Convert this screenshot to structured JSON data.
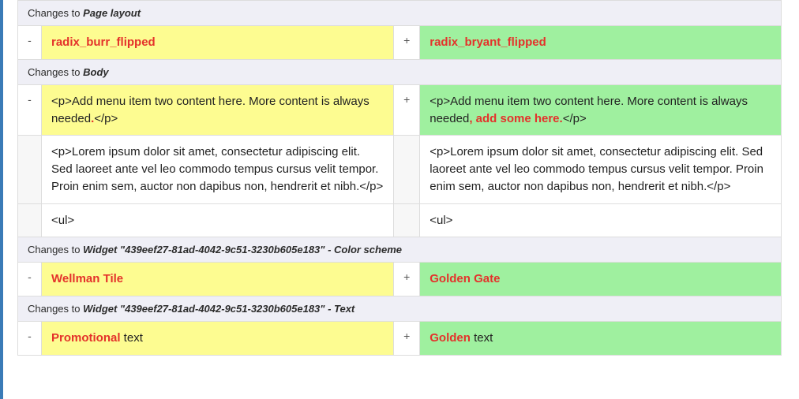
{
  "sections": [
    {
      "title_prefix": "Changes to ",
      "title_em": "Page layout",
      "title_suffix": "",
      "rows": [
        {
          "type": "change",
          "minus": "-",
          "plus": "+",
          "left_hl": "radix_burr_flipped",
          "left_plain": "",
          "right_hl": "radix_bryant_flipped",
          "right_plain": ""
        }
      ]
    },
    {
      "title_prefix": "Changes to ",
      "title_em": "Body",
      "title_suffix": "",
      "rows": [
        {
          "type": "change",
          "minus": "-",
          "plus": "+",
          "left_plain_pre": "<p>Add menu item two content here. More content is always needed",
          "left_hl": ".",
          "left_plain_post": "</p>",
          "right_plain_pre": "<p>Add menu item two content here. More content is always needed",
          "right_hl": ", add some here.",
          "right_plain_post": "</p>"
        },
        {
          "type": "context",
          "left": "<p>Lorem ipsum dolor sit amet, consectetur adipiscing elit. Sed laoreet ante vel leo commodo tempus cursus velit tempor. Proin enim sem, auctor non dapibus non, hendrerit et nibh.</p>",
          "right": "<p>Lorem ipsum dolor sit amet, consectetur adipiscing elit. Sed laoreet ante vel leo commodo tempus cursus velit tempor. Proin enim sem, auctor non dapibus non, hendrerit et nibh.</p>"
        },
        {
          "type": "context",
          "left": "<ul>",
          "right": "<ul>"
        }
      ]
    },
    {
      "title_prefix": "Changes to ",
      "title_em": "Widget \"439eef27-81ad-4042-9c51-3230b605e183\" - Color scheme",
      "title_suffix": "",
      "rows": [
        {
          "type": "change",
          "minus": "-",
          "plus": "+",
          "left_hl": "Wellman Tile",
          "left_plain": "",
          "right_hl": "Golden Gate",
          "right_plain": ""
        }
      ]
    },
    {
      "title_prefix": "Changes to ",
      "title_em": "Widget \"439eef27-81ad-4042-9c51-3230b605e183\" - Text",
      "title_suffix": "",
      "rows": [
        {
          "type": "change",
          "minus": "-",
          "plus": "+",
          "left_hl": "Promotional",
          "left_plain": " text",
          "right_hl": "Golden",
          "right_plain": " text"
        }
      ]
    }
  ]
}
